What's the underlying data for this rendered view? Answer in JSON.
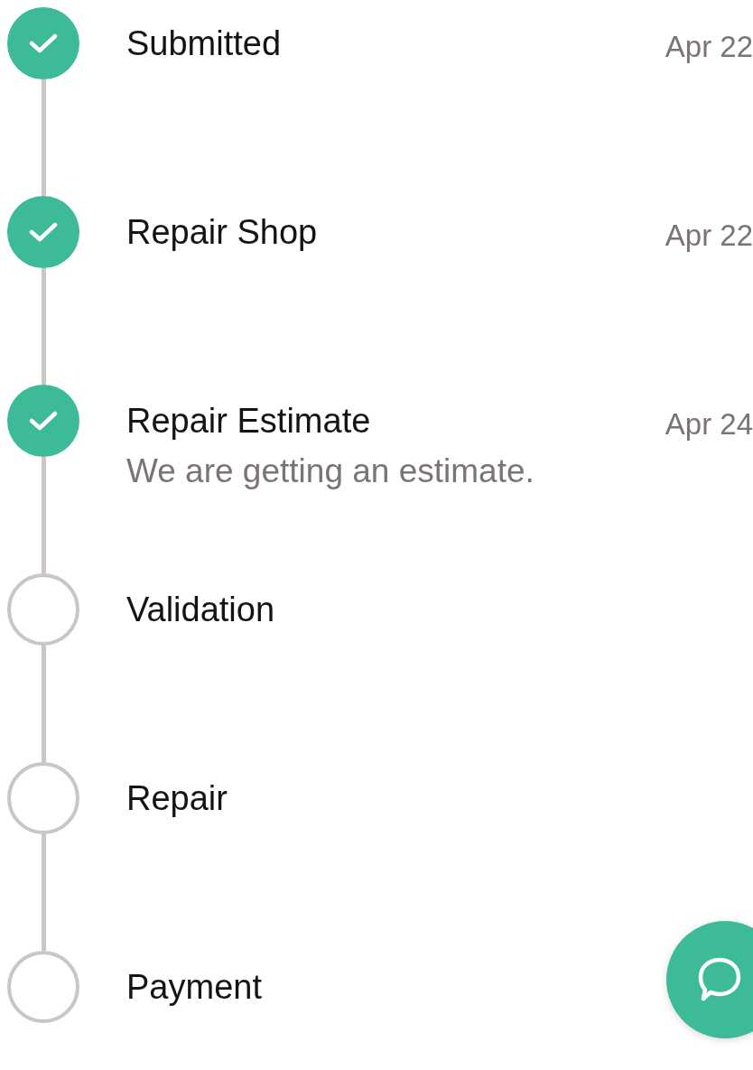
{
  "steps": [
    {
      "title": "Submitted",
      "date": "Apr 22",
      "done": true
    },
    {
      "title": "Repair Shop",
      "date": "Apr 22",
      "done": true
    },
    {
      "title": "Repair Estimate",
      "date": "Apr 24",
      "description": "We are getting an estimate.",
      "done": true
    },
    {
      "title": "Validation",
      "done": false
    },
    {
      "title": "Repair",
      "done": false
    },
    {
      "title": "Payment",
      "done": false
    }
  ],
  "chat_button": {
    "kind": "chat"
  }
}
